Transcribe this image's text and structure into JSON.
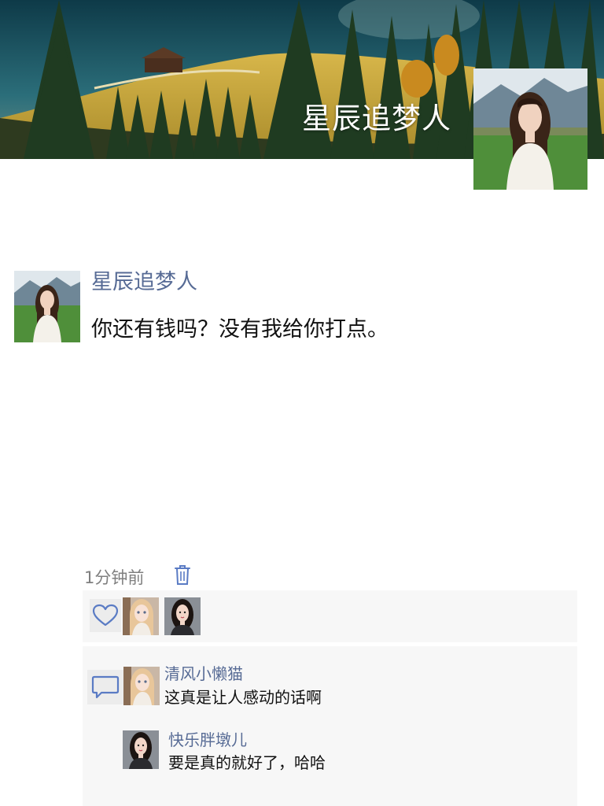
{
  "profile": {
    "cover_name": "星辰追梦人",
    "avatar_icon": "woman-portrait-avatar"
  },
  "post": {
    "author": "星辰追梦人",
    "text": "你还有钱吗？没有我给你打点。",
    "time": "1分钟前",
    "delete_icon": "trash-icon"
  },
  "likes": {
    "icon": "heart-icon",
    "avatars": [
      "anime-girl-avatar",
      "woman-portrait-avatar"
    ]
  },
  "comments": {
    "icon": "comment-bubble-icon",
    "items": [
      {
        "name": "清风小懒猫",
        "text": "这真是让人感动的话啊",
        "avatar": "anime-girl-avatar"
      },
      {
        "name": "快乐胖墩儿",
        "text": "要是真的就好了，哈哈",
        "avatar": "woman-portrait-avatar"
      }
    ]
  },
  "colors": {
    "link_name": "#576b95",
    "panel_bg": "#f7f7f7",
    "icon_blue": "#5a7bc4"
  }
}
